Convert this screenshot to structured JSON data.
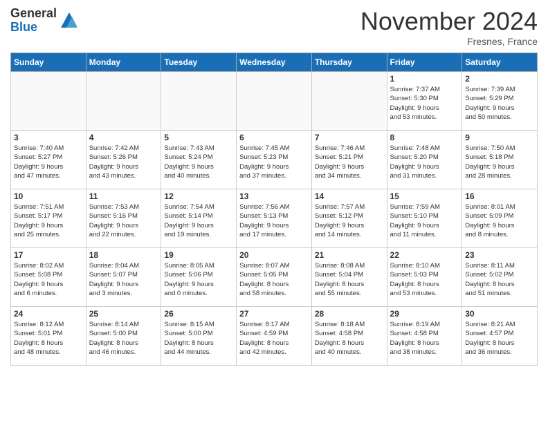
{
  "logo": {
    "general": "General",
    "blue": "Blue"
  },
  "header": {
    "month": "November 2024",
    "location": "Fresnes, France"
  },
  "weekdays": [
    "Sunday",
    "Monday",
    "Tuesday",
    "Wednesday",
    "Thursday",
    "Friday",
    "Saturday"
  ],
  "weeks": [
    [
      {
        "day": "",
        "info": ""
      },
      {
        "day": "",
        "info": ""
      },
      {
        "day": "",
        "info": ""
      },
      {
        "day": "",
        "info": ""
      },
      {
        "day": "",
        "info": ""
      },
      {
        "day": "1",
        "info": "Sunrise: 7:37 AM\nSunset: 5:30 PM\nDaylight: 9 hours\nand 53 minutes."
      },
      {
        "day": "2",
        "info": "Sunrise: 7:39 AM\nSunset: 5:29 PM\nDaylight: 9 hours\nand 50 minutes."
      }
    ],
    [
      {
        "day": "3",
        "info": "Sunrise: 7:40 AM\nSunset: 5:27 PM\nDaylight: 9 hours\nand 47 minutes."
      },
      {
        "day": "4",
        "info": "Sunrise: 7:42 AM\nSunset: 5:26 PM\nDaylight: 9 hours\nand 43 minutes."
      },
      {
        "day": "5",
        "info": "Sunrise: 7:43 AM\nSunset: 5:24 PM\nDaylight: 9 hours\nand 40 minutes."
      },
      {
        "day": "6",
        "info": "Sunrise: 7:45 AM\nSunset: 5:23 PM\nDaylight: 9 hours\nand 37 minutes."
      },
      {
        "day": "7",
        "info": "Sunrise: 7:46 AM\nSunset: 5:21 PM\nDaylight: 9 hours\nand 34 minutes."
      },
      {
        "day": "8",
        "info": "Sunrise: 7:48 AM\nSunset: 5:20 PM\nDaylight: 9 hours\nand 31 minutes."
      },
      {
        "day": "9",
        "info": "Sunrise: 7:50 AM\nSunset: 5:18 PM\nDaylight: 9 hours\nand 28 minutes."
      }
    ],
    [
      {
        "day": "10",
        "info": "Sunrise: 7:51 AM\nSunset: 5:17 PM\nDaylight: 9 hours\nand 25 minutes."
      },
      {
        "day": "11",
        "info": "Sunrise: 7:53 AM\nSunset: 5:16 PM\nDaylight: 9 hours\nand 22 minutes."
      },
      {
        "day": "12",
        "info": "Sunrise: 7:54 AM\nSunset: 5:14 PM\nDaylight: 9 hours\nand 19 minutes."
      },
      {
        "day": "13",
        "info": "Sunrise: 7:56 AM\nSunset: 5:13 PM\nDaylight: 9 hours\nand 17 minutes."
      },
      {
        "day": "14",
        "info": "Sunrise: 7:57 AM\nSunset: 5:12 PM\nDaylight: 9 hours\nand 14 minutes."
      },
      {
        "day": "15",
        "info": "Sunrise: 7:59 AM\nSunset: 5:10 PM\nDaylight: 9 hours\nand 11 minutes."
      },
      {
        "day": "16",
        "info": "Sunrise: 8:01 AM\nSunset: 5:09 PM\nDaylight: 9 hours\nand 8 minutes."
      }
    ],
    [
      {
        "day": "17",
        "info": "Sunrise: 8:02 AM\nSunset: 5:08 PM\nDaylight: 9 hours\nand 6 minutes."
      },
      {
        "day": "18",
        "info": "Sunrise: 8:04 AM\nSunset: 5:07 PM\nDaylight: 9 hours\nand 3 minutes."
      },
      {
        "day": "19",
        "info": "Sunrise: 8:05 AM\nSunset: 5:06 PM\nDaylight: 9 hours\nand 0 minutes."
      },
      {
        "day": "20",
        "info": "Sunrise: 8:07 AM\nSunset: 5:05 PM\nDaylight: 8 hours\nand 58 minutes."
      },
      {
        "day": "21",
        "info": "Sunrise: 8:08 AM\nSunset: 5:04 PM\nDaylight: 8 hours\nand 55 minutes."
      },
      {
        "day": "22",
        "info": "Sunrise: 8:10 AM\nSunset: 5:03 PM\nDaylight: 8 hours\nand 53 minutes."
      },
      {
        "day": "23",
        "info": "Sunrise: 8:11 AM\nSunset: 5:02 PM\nDaylight: 8 hours\nand 51 minutes."
      }
    ],
    [
      {
        "day": "24",
        "info": "Sunrise: 8:12 AM\nSunset: 5:01 PM\nDaylight: 8 hours\nand 48 minutes."
      },
      {
        "day": "25",
        "info": "Sunrise: 8:14 AM\nSunset: 5:00 PM\nDaylight: 8 hours\nand 46 minutes."
      },
      {
        "day": "26",
        "info": "Sunrise: 8:15 AM\nSunset: 5:00 PM\nDaylight: 8 hours\nand 44 minutes."
      },
      {
        "day": "27",
        "info": "Sunrise: 8:17 AM\nSunset: 4:59 PM\nDaylight: 8 hours\nand 42 minutes."
      },
      {
        "day": "28",
        "info": "Sunrise: 8:18 AM\nSunset: 4:58 PM\nDaylight: 8 hours\nand 40 minutes."
      },
      {
        "day": "29",
        "info": "Sunrise: 8:19 AM\nSunset: 4:58 PM\nDaylight: 8 hours\nand 38 minutes."
      },
      {
        "day": "30",
        "info": "Sunrise: 8:21 AM\nSunset: 4:57 PM\nDaylight: 8 hours\nand 36 minutes."
      }
    ]
  ]
}
